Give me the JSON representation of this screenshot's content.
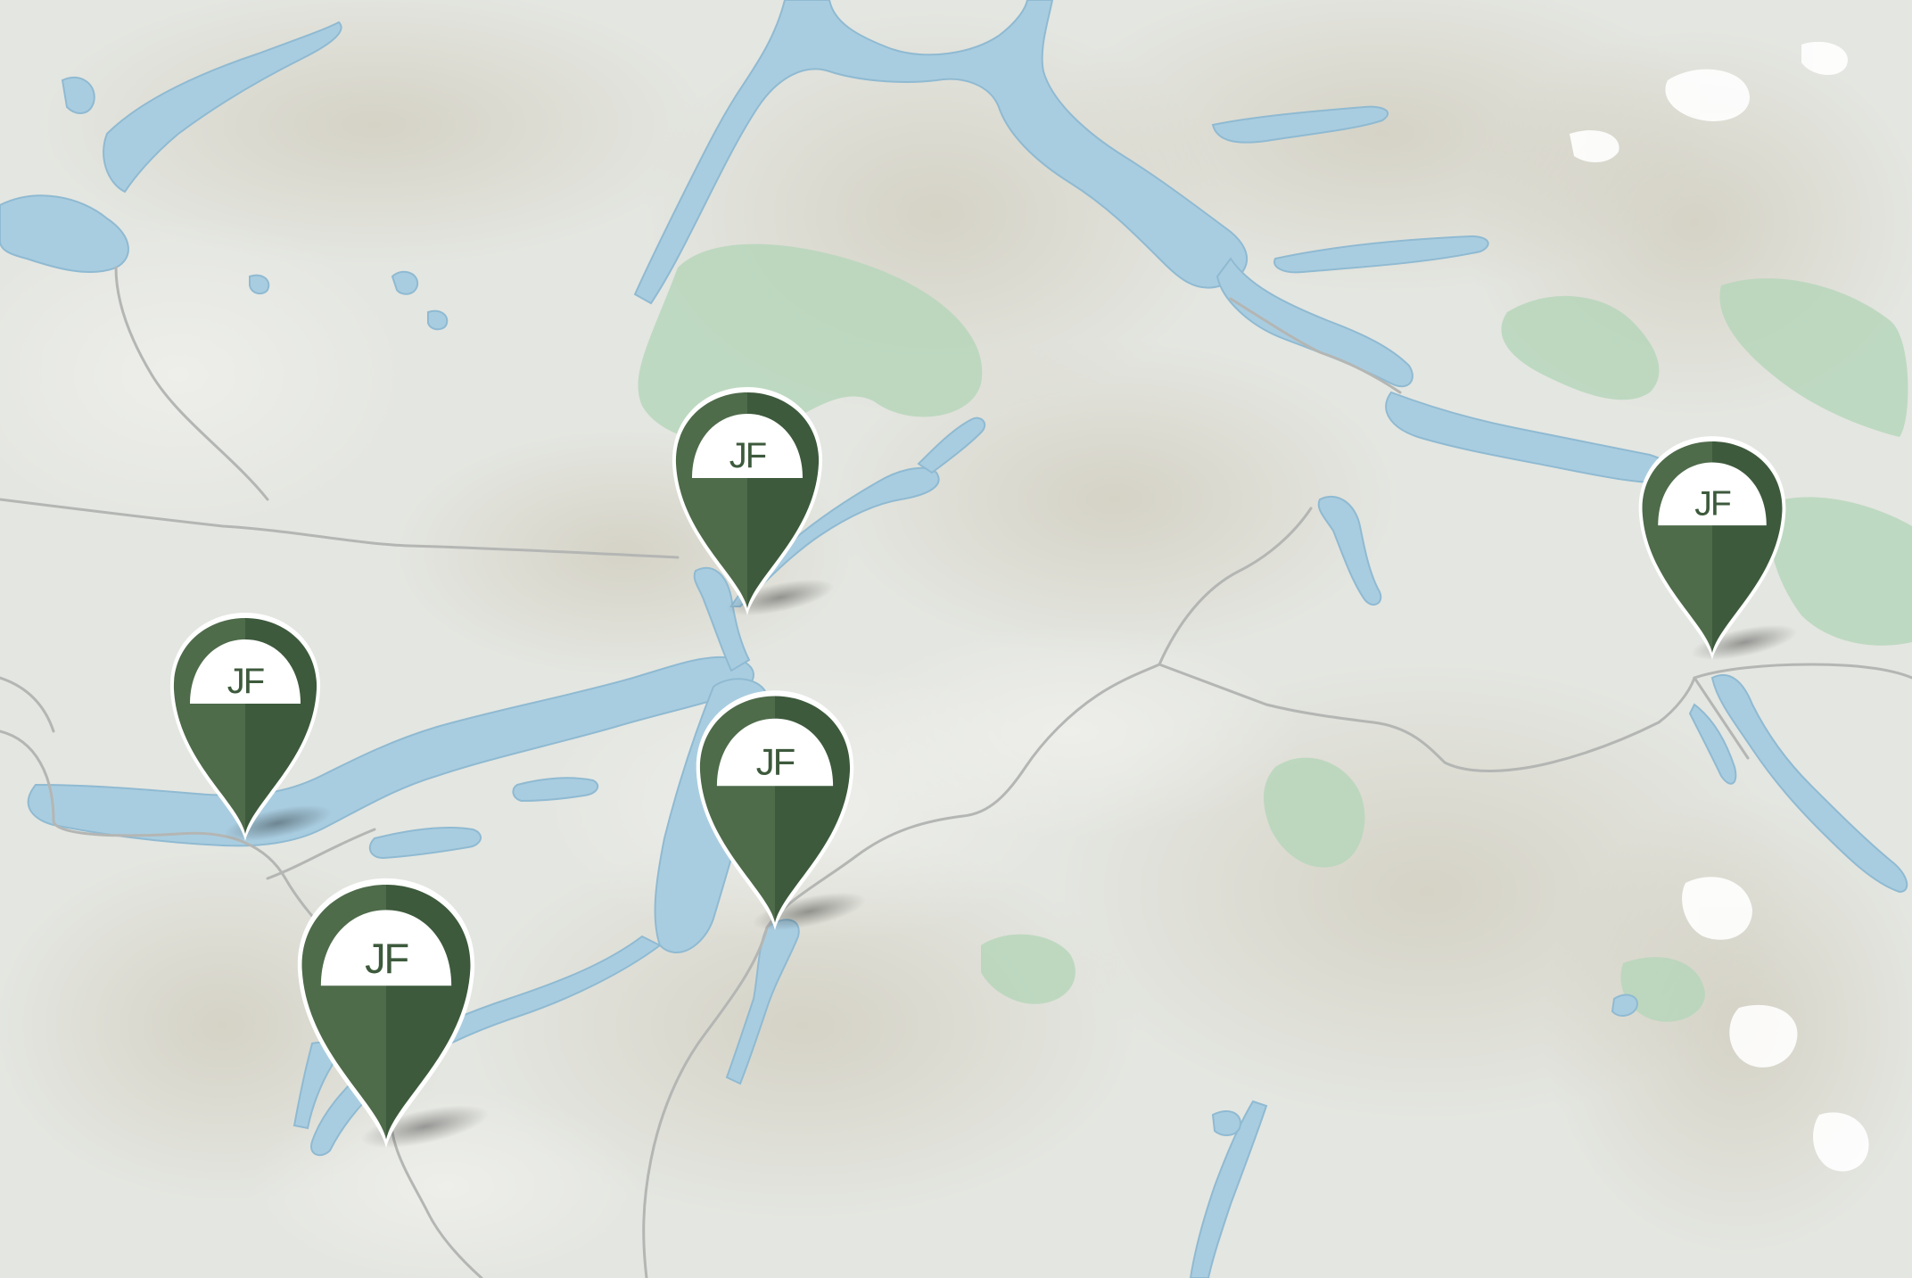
{
  "map": {
    "colors": {
      "land": "#e4e6e1",
      "land_warm": "#ddd8c8",
      "water": "#a9cde0",
      "water_edge": "#8fbad2",
      "forest": "#b7d6bb",
      "road": "#b4b6b4",
      "snow": "#ffffff",
      "pin_light": "#4e6b4a",
      "pin_dark": "#3d5a3c",
      "pin_badge": "#ffffff",
      "pin_text": "#3d5a3c"
    },
    "pins": [
      {
        "id": "pin-1",
        "label": "JF"
      },
      {
        "id": "pin-2",
        "label": "JF"
      },
      {
        "id": "pin-3",
        "label": "JF"
      },
      {
        "id": "pin-4",
        "label": "JF"
      },
      {
        "id": "pin-5",
        "label": "JF"
      }
    ]
  }
}
